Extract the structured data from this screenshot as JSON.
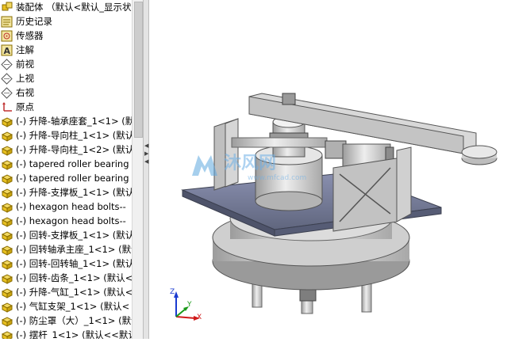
{
  "feature_tree": {
    "title": "装配体 （默认<默认_显示状态-",
    "items": [
      {
        "icon": "history-icon",
        "label": "历史记录"
      },
      {
        "icon": "sensor-icon",
        "label": "传感器"
      },
      {
        "icon": "annotation-icon",
        "label": "注解"
      },
      {
        "icon": "plane-icon",
        "label": "前视"
      },
      {
        "icon": "plane-icon",
        "label": "上视"
      },
      {
        "icon": "plane-icon",
        "label": "右视"
      },
      {
        "icon": "origin-icon",
        "label": "原点"
      },
      {
        "icon": "part-icon",
        "label": "(-) 升降-轴承座套_1<1> (默认"
      },
      {
        "icon": "part-icon",
        "label": "(-) 升降-导向柱_1<1> (默认"
      },
      {
        "icon": "part-icon",
        "label": "(-) 升降-导向柱_1<2> (默认"
      },
      {
        "icon": "part-icon",
        "label": "(-) tapered roller bearing"
      },
      {
        "icon": "part-icon",
        "label": "(-) tapered roller bearing"
      },
      {
        "icon": "part-icon",
        "label": "(-) 升降-支撑板_1<1> (默认"
      },
      {
        "icon": "part-icon",
        "label": "(-) hexagon head bolts--"
      },
      {
        "icon": "part-icon",
        "label": "(-) hexagon head bolts--"
      },
      {
        "icon": "part-icon",
        "label": "(-) 回转-支撑板_1<1> (默认"
      },
      {
        "icon": "part-icon",
        "label": "(-) 回转轴承主座_1<1> (默认"
      },
      {
        "icon": "part-icon",
        "label": "(-) 回转-回转轴_1<1> (默认"
      },
      {
        "icon": "part-icon",
        "label": "(-) 回转-齿条_1<1> (默认<"
      },
      {
        "icon": "part-icon",
        "label": "(-) 升降-气缸_1<1> (默认<"
      },
      {
        "icon": "part-icon",
        "label": "(-) 气缸支架_1<1> (默认<"
      },
      {
        "icon": "part-icon",
        "label": "(-) 防尘罩（大）_1<1> (默认"
      },
      {
        "icon": "part-icon",
        "label": "(-) 摆杆_1<1> (默认<<默认"
      }
    ]
  },
  "watermark": {
    "brand": "沐风网",
    "url": "www.mfcad.com"
  },
  "axes": {
    "x": "X",
    "y": "Y",
    "z": "Z"
  },
  "colors": {
    "tree_bg": "#ffffff",
    "viewport_bg": "#ffffff",
    "plate": "#7c82a0",
    "metal": "#d4d4d4",
    "part_icon": "#e8c020"
  }
}
